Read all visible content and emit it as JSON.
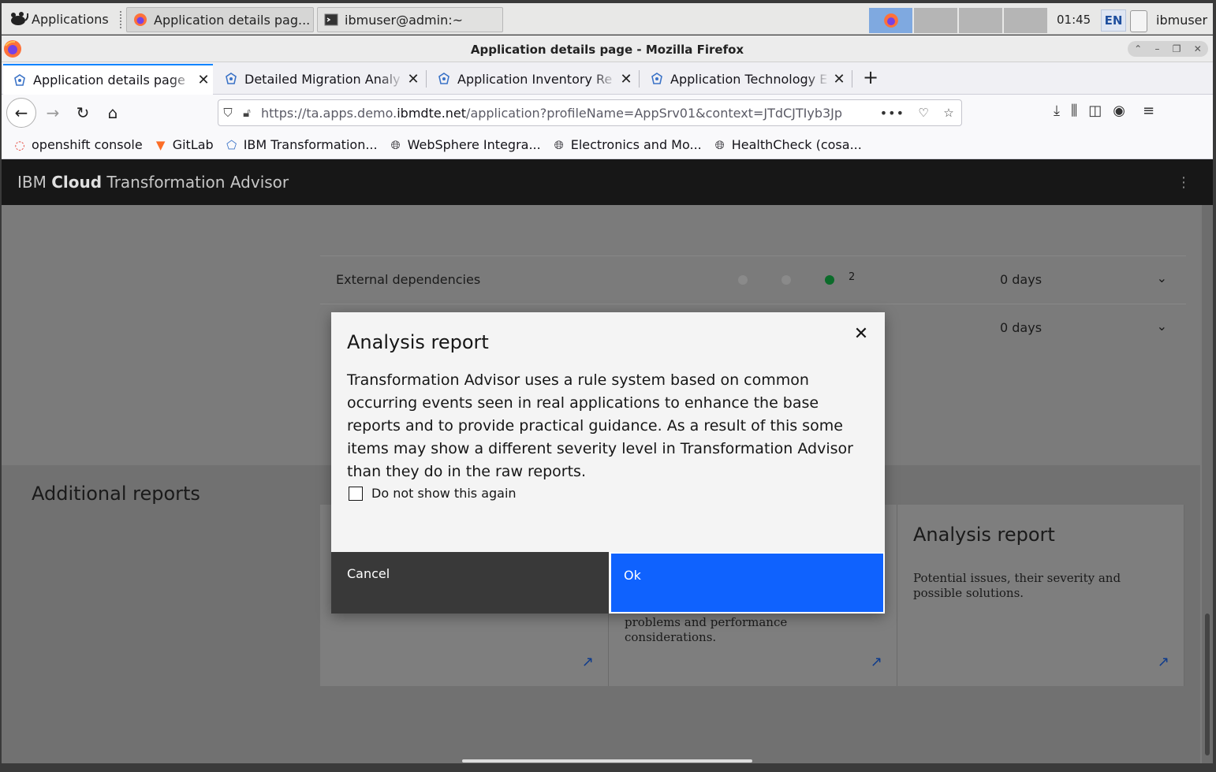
{
  "taskbar": {
    "apps_label": "Applications",
    "tasks": [
      {
        "label": "Application details pag..."
      },
      {
        "label": "ibmuser@admin:~"
      }
    ],
    "clock": "01:45",
    "lang": "EN",
    "user": "ibmuser"
  },
  "window": {
    "title": "Application details page - Mozilla Firefox"
  },
  "tabs": [
    {
      "label": "Application details page",
      "active": true
    },
    {
      "label": "Detailed Migration Analy",
      "active": false
    },
    {
      "label": "Application Inventory Re",
      "active": false
    },
    {
      "label": "Application Technology E",
      "active": false
    }
  ],
  "urlbar": {
    "prefix": "https://ta.apps.demo.",
    "domain": "ibmdte.net",
    "path": "/application?profileName=AppSrv01&context=JTdCJTIyb3Jp",
    "tail": "•••"
  },
  "bookmarks": [
    {
      "label": "openshift console",
      "icon": "openshift-icon"
    },
    {
      "label": "GitLab",
      "icon": "gitlab-icon"
    },
    {
      "label": "IBM Transformation...",
      "icon": "ta-icon"
    },
    {
      "label": "WebSphere Integra...",
      "icon": "globe-icon"
    },
    {
      "label": "Electronics and Mo...",
      "icon": "globe-icon"
    },
    {
      "label": "HealthCheck (cosa...",
      "icon": "globe-icon"
    }
  ],
  "app": {
    "title_prefix": "IBM",
    "title_strong": "Cloud",
    "title_suffix": "Transformation Advisor"
  },
  "rows": [
    {
      "label": "External dependencies",
      "count": "2",
      "days": "0 days"
    },
    {
      "label": "",
      "count": "",
      "days": "0 days"
    }
  ],
  "additional": {
    "title": "Additional reports",
    "cards": [
      {
        "title": "",
        "desc": ""
      },
      {
        "title": "",
        "desc": "problems and performance considerations."
      },
      {
        "title": "Analysis report",
        "desc": "Potential issues, their severity and possible solutions."
      }
    ]
  },
  "modal": {
    "title": "Analysis report",
    "body": "Transformation Advisor uses a rule system based on common occurring events seen in real applications to enhance the base reports and to provide practical guidance. As a result of this some items may show a different severity level in Transformation Advisor than they do in the raw reports.",
    "checkbox_label": "Do not show this again",
    "cancel_label": "Cancel",
    "ok_label": "Ok"
  },
  "colors": {
    "primary": "#0f62fe",
    "header": "#171717",
    "overlay_bg": "#7b7b7b",
    "status_green": "#0b6b2a"
  }
}
